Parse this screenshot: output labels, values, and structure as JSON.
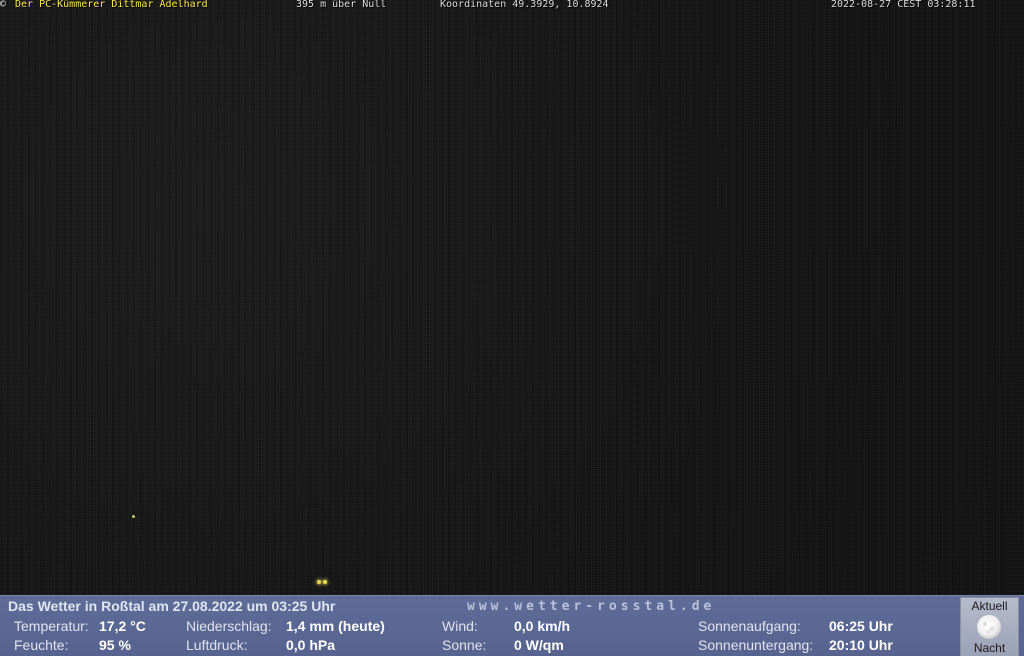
{
  "overlay": {
    "copyright_symbol": "©",
    "owner": "Der PC-Kümmerer Dittmar Adelhard",
    "altitude": "395 m über Null",
    "coordinates": "Koordinaten 49.3929, 10.8924",
    "timestamp": "2022-08-27 CEST 03:28:11"
  },
  "weather": {
    "title": "Das Wetter in Roßtal am 27.08.2022 um 03:25 Uhr",
    "url": "www.wetter-rosstal.de",
    "temperature_label": "Temperatur:",
    "temperature_value": "17,2 °C",
    "humidity_label": "Feuchte:",
    "humidity_value": "95 %",
    "precipitation_label": "Niederschlag:",
    "precipitation_value": "1,4 mm (heute)",
    "pressure_label": "Luftdruck:",
    "pressure_value": "0,0 hPa",
    "wind_label": "Wind:",
    "wind_value": "0,0 km/h",
    "sun_label": "Sonne:",
    "sun_value": "0 W/qm",
    "sunrise_label": "Sonnenaufgang:",
    "sunrise_value": "06:25 Uhr",
    "sunset_label": "Sonnenuntergang:",
    "sunset_value": "20:10 Uhr"
  },
  "moon": {
    "current_label": "Aktuell",
    "phase_label": "Nacht",
    "icon": "moon-icon"
  },
  "colors": {
    "owner_text": "#ffe94a",
    "panel_background": "#5f6c98"
  }
}
